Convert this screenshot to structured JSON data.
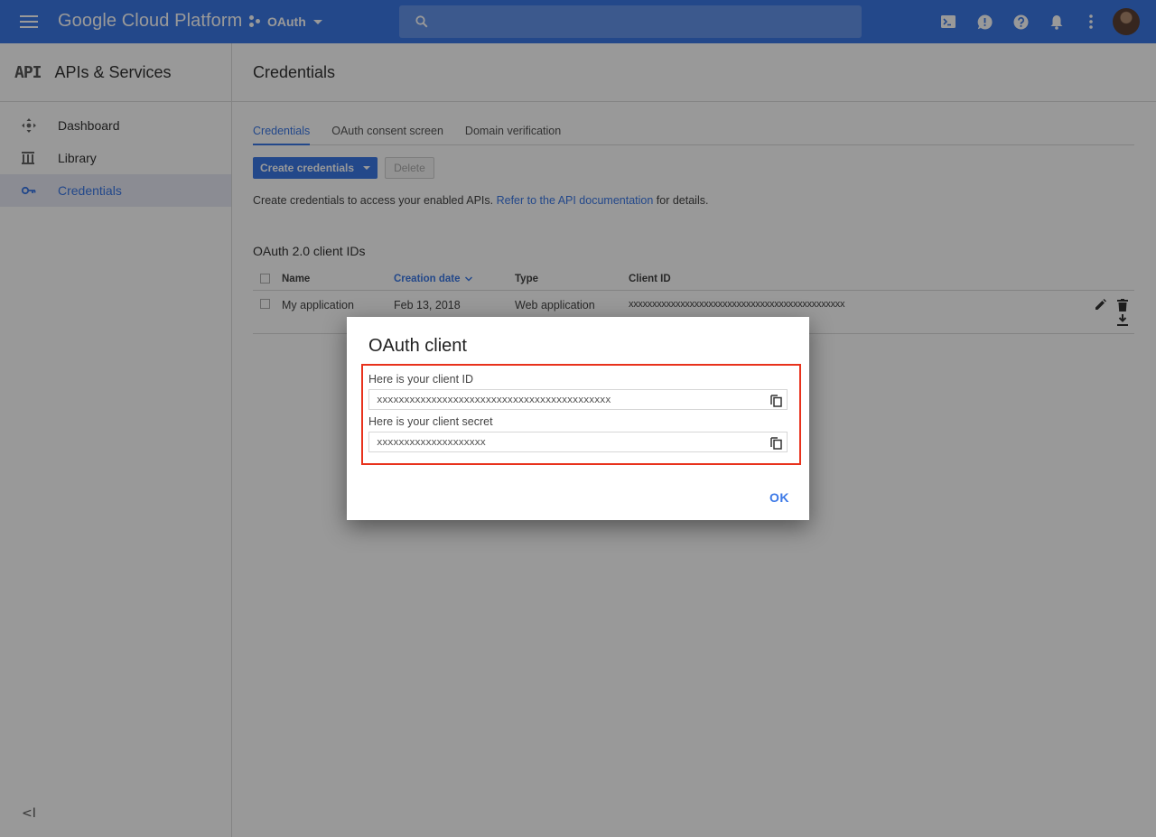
{
  "topbar": {
    "brand": "Google Cloud Platform",
    "project_name": "OAuth",
    "search_placeholder": "",
    "icons": [
      "cloud-shell-icon",
      "feedback-icon",
      "help-icon",
      "notifications-icon",
      "more-vert-icon",
      "account-avatar"
    ]
  },
  "sidebar": {
    "logo": "API",
    "title": "APIs & Services",
    "items": [
      {
        "label": "Dashboard",
        "icon": "dashboard-icon",
        "active": false
      },
      {
        "label": "Library",
        "icon": "library-icon",
        "active": false
      },
      {
        "label": "Credentials",
        "icon": "key-icon",
        "active": true
      }
    ],
    "collapse_label": "<I"
  },
  "main": {
    "page_title": "Credentials",
    "tabs": [
      {
        "label": "Credentials",
        "active": true
      },
      {
        "label": "OAuth consent screen",
        "active": false
      },
      {
        "label": "Domain verification",
        "active": false
      }
    ],
    "create_button": "Create credentials",
    "delete_button": "Delete",
    "description_prefix": "Create credentials to access your enabled APIs. ",
    "description_link": "Refer to the API documentation",
    "description_suffix": " for details.",
    "section_title": "OAuth 2.0 client IDs",
    "table": {
      "headers": {
        "name": "Name",
        "date": "Creation date",
        "type": "Type",
        "client_id": "Client ID"
      },
      "rows": [
        {
          "name": "My application",
          "date": "Feb 13, 2018",
          "type": "Web application",
          "client_id": "xxxxxxxxxxxxxxxxxxxxxxxxxxxxxxxxxxxxxxxxxxxxxx"
        }
      ]
    }
  },
  "dialog": {
    "title": "OAuth client",
    "client_id_label": "Here is your client ID",
    "client_id_value": "xxxxxxxxxxxxxxxxxxxxxxxxxxxxxxxxxxxxxxxxxxx",
    "client_secret_label": "Here is your client secret",
    "client_secret_value": "xxxxxxxxxxxxxxxxxxxx",
    "ok_label": "OK"
  },
  "colors": {
    "brand_blue": "#3b78e7",
    "highlight_red": "#e8321c"
  }
}
